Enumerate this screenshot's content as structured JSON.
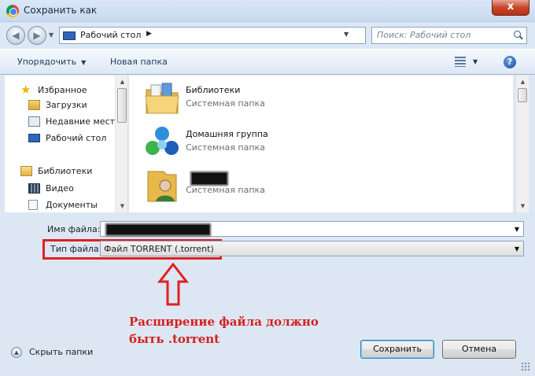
{
  "window": {
    "title": "Сохранить как",
    "close_label": "x",
    "app_icon": "chrome-icon"
  },
  "address": {
    "location": "Рабочий стол",
    "search_placeholder": "Поиск: Рабочий стол"
  },
  "toolbar": {
    "organize": "Упорядочить",
    "new_folder": "Новая папка",
    "help": "?"
  },
  "nav": {
    "items": [
      {
        "label": "Избранное",
        "icon": "star-icon"
      },
      {
        "label": "Загрузки",
        "icon": "downloads-icon"
      },
      {
        "label": "Недавние места",
        "icon": "recent-places-icon"
      },
      {
        "label": "Рабочий стол",
        "icon": "desktop-icon"
      },
      {
        "label": "Библиотеки",
        "icon": "libraries-icon"
      },
      {
        "label": "Видео",
        "icon": "video-icon"
      },
      {
        "label": "Документы",
        "icon": "documents-icon"
      }
    ]
  },
  "files": {
    "items": [
      {
        "name": "Библиотеки",
        "type": "Системная папка",
        "icon": "libraries-folder-icon"
      },
      {
        "name": "Домашняя группа",
        "type": "Системная папка",
        "icon": "homegroup-icon"
      },
      {
        "name": "",
        "type": "Системная папка",
        "icon": "user-folder-icon"
      }
    ]
  },
  "form": {
    "filename_label": "Имя файла:",
    "filename_value": "",
    "filetype_label": "Тип файла:",
    "filetype_value": "Файл TORRENT (.torrent)"
  },
  "annotation": {
    "line1": "Расширение файла должно",
    "line2": "быть .torrent",
    "color": "#e02121"
  },
  "footer": {
    "hide_folders": "Скрыть папки",
    "save": "Сохранить",
    "cancel": "Отмена"
  }
}
